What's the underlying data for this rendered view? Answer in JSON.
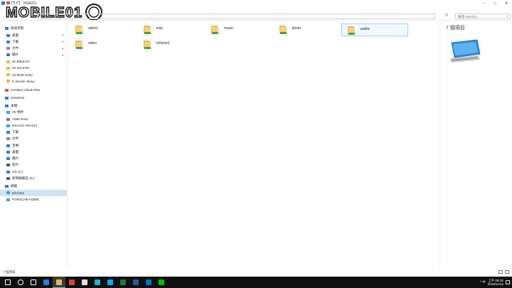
{
  "window": {
    "title": "NSA221",
    "controls": [
      "–",
      "□",
      "✕"
    ]
  },
  "address_bar": {
    "path": "網路 > NSA221",
    "search_placeholder": "搜尋 NSA221"
  },
  "navigation": {
    "items": [
      {
        "label": "快速存取",
        "icon": "star-icon",
        "color": "#2f7bd8",
        "pinned": false,
        "level": 0
      },
      {
        "label": "桌面",
        "icon": "desktop-icon",
        "color": "#2f7bd8",
        "pinned": true,
        "level": 1
      },
      {
        "label": "下載",
        "icon": "download-icon",
        "color": "#2f7bd8",
        "pinned": true,
        "level": 1
      },
      {
        "label": "文件",
        "icon": "document-icon",
        "color": "#8a8a8a",
        "pinned": true,
        "level": 1
      },
      {
        "label": "圖片",
        "icon": "picture-icon",
        "color": "#2f7bd8",
        "pinned": true,
        "level": 1
      },
      {
        "label": "01-B353-H7",
        "icon": "folder-icon",
        "color": "#e6b84f",
        "pinned": false,
        "level": 1
      },
      {
        "label": "02-SN-6707",
        "icon": "folder-icon",
        "color": "#e6b84f",
        "pinned": false,
        "level": 1
      },
      {
        "label": "03-MGE-5153",
        "icon": "folder-icon",
        "color": "#e6b84f",
        "pinned": false,
        "level": 1
      },
      {
        "label": "K-Suzuki Jimny",
        "icon": "folder-icon",
        "color": "#e6b84f",
        "pinned": false,
        "level": 1
      },
      {
        "label": "Creative Cloud Files",
        "icon": "creative-cloud-icon",
        "color": "#d9534f",
        "pinned": false,
        "level": 0
      },
      {
        "label": "OneDrive",
        "icon": "cloud-icon",
        "color": "#2f7bd8",
        "pinned": false,
        "level": 0
      },
      {
        "label": "本機",
        "icon": "computer-icon",
        "color": "#2f7bd8",
        "pinned": false,
        "level": 0
      },
      {
        "label": "3D 物件",
        "icon": "cube-icon",
        "color": "#3aa0d8",
        "pinned": false,
        "level": 1
      },
      {
        "label": "A360 Drive",
        "icon": "drive-icon",
        "color": "#777777",
        "pinned": false,
        "level": 1
      },
      {
        "label": "NSA221 NSA221",
        "icon": "network-drive-icon",
        "color": "#3aa0d8",
        "pinned": false,
        "level": 1
      },
      {
        "label": "下載",
        "icon": "download-icon",
        "color": "#2f7bd8",
        "pinned": false,
        "level": 1
      },
      {
        "label": "文件",
        "icon": "document-icon",
        "color": "#8a8a8a",
        "pinned": false,
        "level": 1
      },
      {
        "label": "音樂",
        "icon": "music-icon",
        "color": "#2f7bd8",
        "pinned": false,
        "level": 1
      },
      {
        "label": "桌面",
        "icon": "desktop-icon",
        "color": "#2f7bd8",
        "pinned": false,
        "level": 1
      },
      {
        "label": "圖片",
        "icon": "picture-icon",
        "color": "#2f7bd8",
        "pinned": false,
        "level": 1
      },
      {
        "label": "影片",
        "icon": "video-icon",
        "color": "#555555",
        "pinned": false,
        "level": 1
      },
      {
        "label": "OS (C:)",
        "icon": "disk-icon",
        "color": "#2f7bd8",
        "pinned": false,
        "level": 1
      },
      {
        "label": "新增磁碟區 (D:)",
        "icon": "disk-icon",
        "color": "#555555",
        "pinned": false,
        "level": 1
      },
      {
        "label": "網路",
        "icon": "network-icon",
        "color": "#2f7bd8",
        "pinned": false,
        "level": 0
      },
      {
        "label": "NSA221",
        "icon": "computer-icon",
        "color": "#3aa0d8",
        "pinned": false,
        "level": 1,
        "selected": true
      },
      {
        "label": "PORSCHE-HOME",
        "icon": "computer-icon",
        "color": "#3aa0d8",
        "pinned": false,
        "level": 1
      }
    ]
  },
  "files": [
    {
      "name": "admin"
    },
    {
      "name": "miui"
    },
    {
      "name": "music"
    },
    {
      "name": "photo"
    },
    {
      "name": "public",
      "selected": true
    },
    {
      "name": "video"
    },
    {
      "name": "Volume1"
    }
  ],
  "details": {
    "count_label": "7 個項目"
  },
  "status_bar": {
    "text": "7 個項目"
  },
  "taskbar": {
    "apps": [
      {
        "name": "start-icon",
        "color": "#ffffff"
      },
      {
        "name": "search-icon",
        "color": "#ffffff"
      },
      {
        "name": "task-view-icon",
        "color": "#ffffff"
      },
      {
        "name": "edge-icon",
        "color": "#2f7bd8"
      },
      {
        "name": "file-explorer-icon",
        "color": "#e6b84f",
        "active": true
      },
      {
        "name": "chrome-icon",
        "color": "#db4437"
      },
      {
        "name": "photos-icon",
        "color": "#e0e0e0"
      },
      {
        "name": "ai-icon",
        "color": "#1fb5d3"
      },
      {
        "name": "skype-icon",
        "color": "#00aff0"
      },
      {
        "name": "excel-icon",
        "color": "#1d7a44"
      },
      {
        "name": "word-icon",
        "color": "#2b5797"
      },
      {
        "name": "outlook-icon",
        "color": "#0072c6"
      },
      {
        "name": "line-icon",
        "color": "#00c300"
      }
    ],
    "clock_time": "上午 09:18",
    "clock_date": "2019/11/12",
    "tray_text": "^ 中"
  },
  "watermark": {
    "text": "MOBILE01"
  }
}
